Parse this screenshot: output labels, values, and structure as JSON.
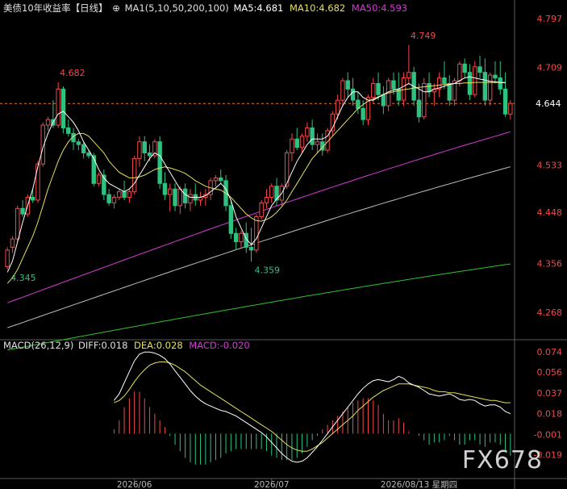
{
  "header": {
    "title": "美债10年收益率【日线】",
    "icon": "target-circle-icon",
    "ma_label": "MA1(5,10,50,200,100)",
    "ma5": "MA5:4.681",
    "ma10": "MA10:4.682",
    "ma50": "MA50:4.593"
  },
  "macd_header": {
    "label": "MACD(26,12,9)",
    "diff": "DIFF:0.018",
    "dea": "DEA:0.028",
    "macd": "MACD:-0.020"
  },
  "colors": {
    "up": "#f24949",
    "down": "#2ec281",
    "ma5": "#ffffff",
    "ma10": "#e6e059",
    "ma50": "#d63ad6",
    "ma100": "#bdbdbd",
    "ma200": "#2ec22e",
    "axis_text": "#f24949",
    "grid": "#333333"
  },
  "watermark": "FX678",
  "chart_data": [
    {
      "type": "candlestick",
      "title": "美债10年收益率【日线】",
      "yaxis_ticks": [
        "4.797",
        "4.709",
        "4.533",
        "4.448",
        "4.356",
        "4.268"
      ],
      "ylim": [
        4.22,
        4.81
      ],
      "current_price": "4.644",
      "annotations": [
        {
          "label": "4.682",
          "index": 10,
          "at": "high"
        },
        {
          "label": "4.345",
          "index": 0,
          "at": "low"
        },
        {
          "label": "4.359",
          "index": 48,
          "at": "low"
        },
        {
          "label": "4.749",
          "index": 79,
          "at": "high"
        }
      ],
      "x_tick_labels": [
        {
          "label": "2026/06",
          "index": 25
        },
        {
          "label": "2026/07",
          "index": 52
        },
        {
          "label": "2026/08/13 星期四",
          "index": 81
        }
      ],
      "ohlc": [
        [
          4.35,
          4.385,
          4.345,
          4.38
        ],
        [
          4.385,
          4.405,
          4.375,
          4.4
        ],
        [
          4.4,
          4.46,
          4.395,
          4.455
        ],
        [
          4.455,
          4.47,
          4.44,
          4.445
        ],
        [
          4.445,
          4.48,
          4.44,
          4.475
        ],
        [
          4.475,
          4.49,
          4.465,
          4.47
        ],
        [
          4.47,
          4.54,
          4.465,
          4.535
        ],
        [
          4.535,
          4.61,
          4.53,
          4.605
        ],
        [
          4.605,
          4.62,
          4.595,
          4.615
        ],
        [
          4.615,
          4.65,
          4.6,
          4.605
        ],
        [
          4.605,
          4.682,
          4.6,
          4.67
        ],
        [
          4.67,
          4.675,
          4.59,
          4.6
        ],
        [
          4.6,
          4.615,
          4.585,
          4.59
        ],
        [
          4.59,
          4.6,
          4.56,
          4.575
        ],
        [
          4.575,
          4.58,
          4.56,
          4.57
        ],
        [
          4.57,
          4.575,
          4.545,
          4.555
        ],
        [
          4.555,
          4.56,
          4.545,
          4.55
        ],
        [
          4.55,
          4.555,
          4.495,
          4.5
        ],
        [
          4.5,
          4.52,
          4.495,
          4.515
        ],
        [
          4.515,
          4.525,
          4.47,
          4.48
        ],
        [
          4.48,
          4.49,
          4.46,
          4.465
        ],
        [
          4.465,
          4.48,
          4.455,
          4.475
        ],
        [
          4.475,
          4.49,
          4.47,
          4.485
        ],
        [
          4.485,
          4.505,
          4.47,
          4.475
        ],
        [
          4.475,
          4.49,
          4.465,
          4.485
        ],
        [
          4.485,
          4.55,
          4.48,
          4.545
        ],
        [
          4.545,
          4.585,
          4.53,
          4.575
        ],
        [
          4.575,
          4.585,
          4.54,
          4.555
        ],
        [
          4.555,
          4.57,
          4.54,
          4.55
        ],
        [
          4.55,
          4.58,
          4.545,
          4.575
        ],
        [
          4.575,
          4.585,
          4.49,
          4.5
        ],
        [
          4.5,
          4.52,
          4.47,
          4.48
        ],
        [
          4.48,
          4.5,
          4.45,
          4.49
        ],
        [
          4.49,
          4.5,
          4.45,
          4.46
        ],
        [
          4.46,
          4.495,
          4.445,
          4.49
        ],
        [
          4.49,
          4.5,
          4.455,
          4.465
        ],
        [
          4.465,
          4.49,
          4.45,
          4.48
        ],
        [
          4.48,
          4.5,
          4.46,
          4.47
        ],
        [
          4.47,
          4.485,
          4.46,
          4.475
        ],
        [
          4.475,
          4.49,
          4.46,
          4.48
        ],
        [
          4.48,
          4.51,
          4.47,
          4.505
        ],
        [
          4.505,
          4.515,
          4.495,
          4.51
        ],
        [
          4.51,
          4.525,
          4.5,
          4.505
        ],
        [
          4.505,
          4.515,
          4.45,
          4.46
        ],
        [
          4.46,
          4.47,
          4.4,
          4.41
        ],
        [
          4.41,
          4.42,
          4.38,
          4.395
        ],
        [
          4.395,
          4.415,
          4.385,
          4.41
        ],
        [
          4.41,
          4.43,
          4.375,
          4.385
        ],
        [
          4.385,
          4.42,
          4.359,
          4.38
        ],
        [
          4.38,
          4.445,
          4.375,
          4.44
        ],
        [
          4.44,
          4.47,
          4.435,
          4.465
        ],
        [
          4.465,
          4.49,
          4.455,
          4.475
        ],
        [
          4.475,
          4.5,
          4.465,
          4.495
        ],
        [
          4.495,
          4.51,
          4.46,
          4.47
        ],
        [
          4.47,
          4.5,
          4.46,
          4.495
        ],
        [
          4.495,
          4.56,
          4.49,
          4.555
        ],
        [
          4.555,
          4.59,
          4.54,
          4.58
        ],
        [
          4.58,
          4.6,
          4.56,
          4.565
        ],
        [
          4.565,
          4.59,
          4.555,
          4.585
        ],
        [
          4.585,
          4.61,
          4.575,
          4.6
        ],
        [
          4.6,
          4.615,
          4.56,
          4.57
        ],
        [
          4.57,
          4.59,
          4.555,
          4.575
        ],
        [
          4.575,
          4.59,
          4.55,
          4.56
        ],
        [
          4.56,
          4.6,
          4.555,
          4.595
        ],
        [
          4.595,
          4.63,
          4.585,
          4.625
        ],
        [
          4.625,
          4.66,
          4.615,
          4.65
        ],
        [
          4.65,
          4.69,
          4.64,
          4.685
        ],
        [
          4.685,
          4.7,
          4.655,
          4.67
        ],
        [
          4.67,
          4.69,
          4.64,
          4.65
        ],
        [
          4.65,
          4.665,
          4.625,
          4.635
        ],
        [
          4.635,
          4.65,
          4.605,
          4.615
        ],
        [
          4.615,
          4.66,
          4.605,
          4.655
        ],
        [
          4.655,
          4.69,
          4.645,
          4.68
        ],
        [
          4.68,
          4.7,
          4.65,
          4.66
        ],
        [
          4.66,
          4.675,
          4.625,
          4.64
        ],
        [
          4.64,
          4.69,
          4.63,
          4.685
        ],
        [
          4.685,
          4.7,
          4.66,
          4.67
        ],
        [
          4.67,
          4.7,
          4.64,
          4.65
        ],
        [
          4.65,
          4.7,
          4.64,
          4.69
        ],
        [
          4.69,
          4.749,
          4.68,
          4.7
        ],
        [
          4.7,
          4.71,
          4.64,
          4.65
        ],
        [
          4.65,
          4.68,
          4.61,
          4.62
        ],
        [
          4.62,
          4.69,
          4.615,
          4.68
        ],
        [
          4.68,
          4.7,
          4.655,
          4.665
        ],
        [
          4.665,
          4.68,
          4.64,
          4.67
        ],
        [
          4.67,
          4.7,
          4.655,
          4.69
        ],
        [
          4.69,
          4.72,
          4.67,
          4.68
        ],
        [
          4.68,
          4.695,
          4.64,
          4.65
        ],
        [
          4.65,
          4.69,
          4.64,
          4.685
        ],
        [
          4.685,
          4.72,
          4.675,
          4.715
        ],
        [
          4.715,
          4.725,
          4.69,
          4.7
        ],
        [
          4.7,
          4.715,
          4.65,
          4.66
        ],
        [
          4.66,
          4.72,
          4.655,
          4.71
        ],
        [
          4.71,
          4.73,
          4.69,
          4.7
        ],
        [
          4.7,
          4.725,
          4.64,
          4.65
        ],
        [
          4.65,
          4.7,
          4.64,
          4.695
        ],
        [
          4.695,
          4.72,
          4.68,
          4.69
        ],
        [
          4.69,
          4.72,
          4.66,
          4.67
        ],
        [
          4.67,
          4.7,
          4.62,
          4.625
        ],
        [
          4.625,
          4.65,
          4.615,
          4.644
        ]
      ],
      "ma5": [
        4.34,
        4.36,
        4.395,
        4.43,
        4.46,
        4.49,
        4.53,
        4.565,
        4.59,
        4.61,
        4.625,
        4.63,
        4.62,
        4.61,
        4.595,
        4.575,
        4.56,
        4.545,
        4.525,
        4.51,
        4.5,
        4.495,
        4.49,
        4.485,
        4.49,
        4.5,
        4.515,
        4.53,
        4.545,
        4.555,
        4.55,
        4.535,
        4.52,
        4.505,
        4.49,
        4.48,
        4.475,
        4.475,
        4.475,
        4.478,
        4.485,
        4.492,
        4.5,
        4.49,
        4.47,
        4.44,
        4.42,
        4.4,
        4.39,
        4.4,
        4.42,
        4.44,
        4.46,
        4.472,
        4.482,
        4.5,
        4.52,
        4.54,
        4.555,
        4.57,
        4.58,
        4.58,
        4.58,
        4.585,
        4.6,
        4.62,
        4.64,
        4.655,
        4.665,
        4.665,
        4.655,
        4.65,
        4.65,
        4.655,
        4.66,
        4.665,
        4.668,
        4.67,
        4.675,
        4.68,
        4.675,
        4.67,
        4.665,
        4.665,
        4.67,
        4.672,
        4.675,
        4.678,
        4.68,
        4.685,
        4.69,
        4.692,
        4.69,
        4.688,
        4.686,
        4.684,
        4.683,
        4.682,
        4.681
      ],
      "ma10": [
        4.32,
        4.33,
        4.345,
        4.365,
        4.385,
        4.405,
        4.43,
        4.46,
        4.49,
        4.515,
        4.54,
        4.56,
        4.575,
        4.585,
        4.59,
        4.59,
        4.585,
        4.575,
        4.565,
        4.555,
        4.54,
        4.53,
        4.52,
        4.515,
        4.51,
        4.51,
        4.512,
        4.515,
        4.52,
        4.525,
        4.528,
        4.53,
        4.528,
        4.525,
        4.522,
        4.518,
        4.512,
        4.505,
        4.5,
        4.495,
        4.492,
        4.49,
        4.488,
        4.482,
        4.475,
        4.465,
        4.455,
        4.445,
        4.438,
        4.433,
        4.432,
        4.435,
        4.44,
        4.448,
        4.458,
        4.47,
        4.485,
        4.5,
        4.515,
        4.53,
        4.545,
        4.555,
        4.565,
        4.575,
        4.585,
        4.595,
        4.605,
        4.615,
        4.625,
        4.635,
        4.642,
        4.648,
        4.652,
        4.656,
        4.66,
        4.663,
        4.665,
        4.667,
        4.669,
        4.67,
        4.672,
        4.673,
        4.674,
        4.675,
        4.676,
        4.677,
        4.678,
        4.679,
        4.68,
        4.68,
        4.681,
        4.681,
        4.682,
        4.682,
        4.682,
        4.682,
        4.682,
        4.682,
        4.682
      ],
      "ma50_endpoints": [
        4.285,
        4.593
      ],
      "ma100_endpoints": [
        4.24,
        4.53
      ],
      "ma200_endpoints": [
        4.2,
        4.355
      ]
    },
    {
      "type": "macd",
      "title": "MACD(26,12,9)",
      "yaxis_ticks": [
        "0.074",
        "0.056",
        "0.037",
        "0.018",
        "-0.001",
        "-0.019"
      ],
      "ylim": [
        -0.04,
        0.08
      ],
      "diff": [
        0.03,
        0.036,
        0.046,
        0.056,
        0.066,
        0.072,
        0.074,
        0.074,
        0.073,
        0.071,
        0.068,
        0.063,
        0.057,
        0.051,
        0.045,
        0.039,
        0.034,
        0.03,
        0.027,
        0.025,
        0.023,
        0.021,
        0.02,
        0.018,
        0.016,
        0.013,
        0.01,
        0.007,
        0.004,
        0.001,
        -0.003,
        -0.008,
        -0.013,
        -0.018,
        -0.022,
        -0.025,
        -0.026,
        -0.025,
        -0.022,
        -0.017,
        -0.012,
        -0.006,
        0.0,
        0.006,
        0.012,
        0.018,
        0.024,
        0.03,
        0.036,
        0.041,
        0.045,
        0.048,
        0.049,
        0.048,
        0.047,
        0.049,
        0.052,
        0.05,
        0.046,
        0.044,
        0.042,
        0.039,
        0.036,
        0.035,
        0.034,
        0.035,
        0.036,
        0.034,
        0.031,
        0.03,
        0.031,
        0.03,
        0.027,
        0.025,
        0.026,
        0.026,
        0.024,
        0.02,
        0.018
      ],
      "dea": [
        0.028,
        0.03,
        0.034,
        0.04,
        0.047,
        0.053,
        0.058,
        0.062,
        0.064,
        0.065,
        0.065,
        0.064,
        0.062,
        0.059,
        0.056,
        0.052,
        0.048,
        0.044,
        0.041,
        0.038,
        0.035,
        0.032,
        0.029,
        0.026,
        0.023,
        0.02,
        0.017,
        0.014,
        0.011,
        0.008,
        0.005,
        0.002,
        -0.002,
        -0.006,
        -0.01,
        -0.013,
        -0.015,
        -0.016,
        -0.016,
        -0.014,
        -0.011,
        -0.008,
        -0.004,
        0.0,
        0.004,
        0.008,
        0.012,
        0.016,
        0.021,
        0.025,
        0.029,
        0.033,
        0.036,
        0.039,
        0.041,
        0.043,
        0.045,
        0.045,
        0.045,
        0.044,
        0.043,
        0.042,
        0.041,
        0.039,
        0.038,
        0.038,
        0.037,
        0.037,
        0.036,
        0.035,
        0.034,
        0.033,
        0.032,
        0.031,
        0.03,
        0.03,
        0.029,
        0.028,
        0.028
      ],
      "macd": [
        0.004,
        0.012,
        0.024,
        0.032,
        0.038,
        0.038,
        0.032,
        0.024,
        0.018,
        0.012,
        0.006,
        -0.002,
        -0.01,
        -0.016,
        -0.022,
        -0.026,
        -0.028,
        -0.028,
        -0.028,
        -0.026,
        -0.024,
        -0.022,
        -0.018,
        -0.016,
        -0.014,
        -0.014,
        -0.014,
        -0.014,
        -0.014,
        -0.014,
        -0.016,
        -0.02,
        -0.022,
        -0.024,
        -0.024,
        -0.024,
        -0.022,
        -0.018,
        -0.012,
        -0.006,
        -0.002,
        0.004,
        0.008,
        0.012,
        0.016,
        0.02,
        0.024,
        0.028,
        0.03,
        0.032,
        0.032,
        0.03,
        0.026,
        0.018,
        0.012,
        0.012,
        0.014,
        0.01,
        0.002,
        0.0,
        -0.002,
        -0.006,
        -0.01,
        -0.008,
        -0.008,
        -0.006,
        -0.002,
        -0.006,
        -0.01,
        -0.01,
        -0.006,
        -0.006,
        -0.01,
        -0.012,
        -0.008,
        -0.008,
        -0.01,
        -0.016,
        -0.02
      ]
    }
  ]
}
